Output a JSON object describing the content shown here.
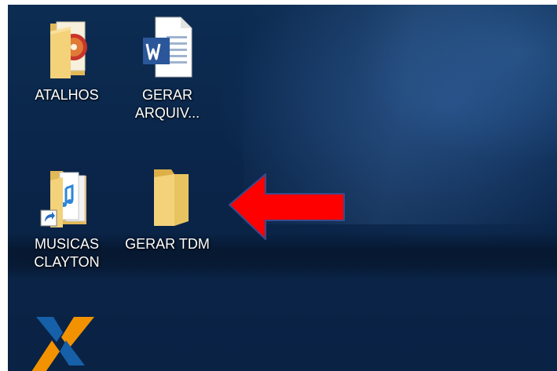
{
  "desktop": {
    "icons": [
      {
        "label": "ATALHOS",
        "icon": "folder-media-icon"
      },
      {
        "label": "GERAR\nARQUIV...",
        "icon": "word-document-icon"
      },
      {
        "label": "MUSICAS\nCLAYTON",
        "icon": "music-folder-shortcut-icon"
      },
      {
        "label": "GERAR TDM",
        "icon": "folder-icon"
      }
    ]
  },
  "annotation": {
    "arrow_color": "#ff0000",
    "arrow_outline": "#3a4a8a"
  },
  "colors": {
    "wallpaper": "#0b2748",
    "folder": "#f3d27a",
    "word_blue": "#2b579a",
    "caixa_blue": "#1560a8",
    "caixa_orange": "#f39200"
  }
}
